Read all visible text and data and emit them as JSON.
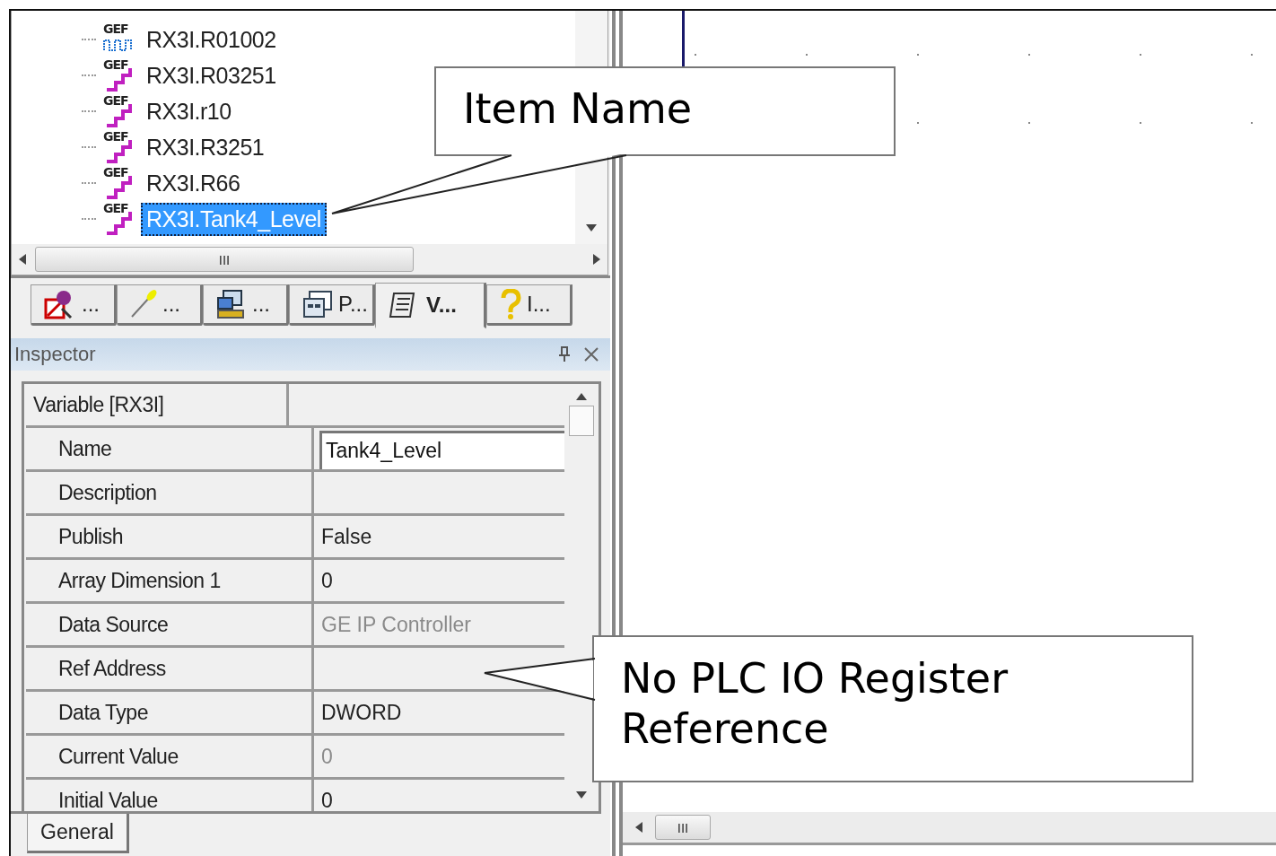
{
  "tree": {
    "items": [
      {
        "label": "RX3I.R01002",
        "badge": "GEF",
        "kind": "wave",
        "selected": false
      },
      {
        "label": "RX3I.R03251",
        "badge": "GEF",
        "kind": "step",
        "selected": false
      },
      {
        "label": "RX3I.r10",
        "badge": "GEF",
        "kind": "step",
        "selected": false
      },
      {
        "label": "RX3I.R3251",
        "badge": "GEF",
        "kind": "step",
        "selected": false
      },
      {
        "label": "RX3I.R66",
        "badge": "GEF",
        "kind": "step",
        "selected": false
      },
      {
        "label": "RX3I.Tank4_Level",
        "badge": "GEF",
        "kind": "step",
        "selected": true
      }
    ],
    "hscroll_grip": "III"
  },
  "tabs": [
    {
      "label": "...",
      "selected": false
    },
    {
      "label": "...",
      "selected": false
    },
    {
      "label": "...",
      "selected": false
    },
    {
      "label": "P...",
      "selected": false
    },
    {
      "label": "V...",
      "selected": true
    },
    {
      "label": "I...",
      "selected": false
    }
  ],
  "inspector": {
    "title": "Inspector",
    "rows": [
      {
        "label": "Variable [RX3I]",
        "kind": "header"
      },
      {
        "label": "Name",
        "value": "Tank4_Level",
        "kind": "edit",
        "disabled": false
      },
      {
        "label": "Description",
        "kind": "text"
      },
      {
        "label": "Publish",
        "value": "False",
        "kind": "text",
        "disabled": false
      },
      {
        "label": "Array Dimension 1",
        "value": "0",
        "kind": "text",
        "disabled": false
      },
      {
        "label": "Data Source",
        "value": "GE IP Controller",
        "kind": "text",
        "disabled": true
      },
      {
        "label": "Ref Address",
        "kind": "text"
      },
      {
        "label": "Data Type",
        "value": "DWORD",
        "kind": "text",
        "disabled": false
      },
      {
        "label": "Current Value",
        "value": "0",
        "kind": "text",
        "disabled": true
      },
      {
        "label": "Initial Value",
        "value": "0",
        "kind": "text",
        "disabled": false
      }
    ],
    "bottom_tabs": [
      {
        "label": "General",
        "selected": true
      }
    ]
  },
  "canvas": {
    "hscroll_grip": "III"
  },
  "callouts": [
    {
      "text": "Item Name"
    },
    {
      "text": "No PLC IO Register Reference"
    }
  ]
}
